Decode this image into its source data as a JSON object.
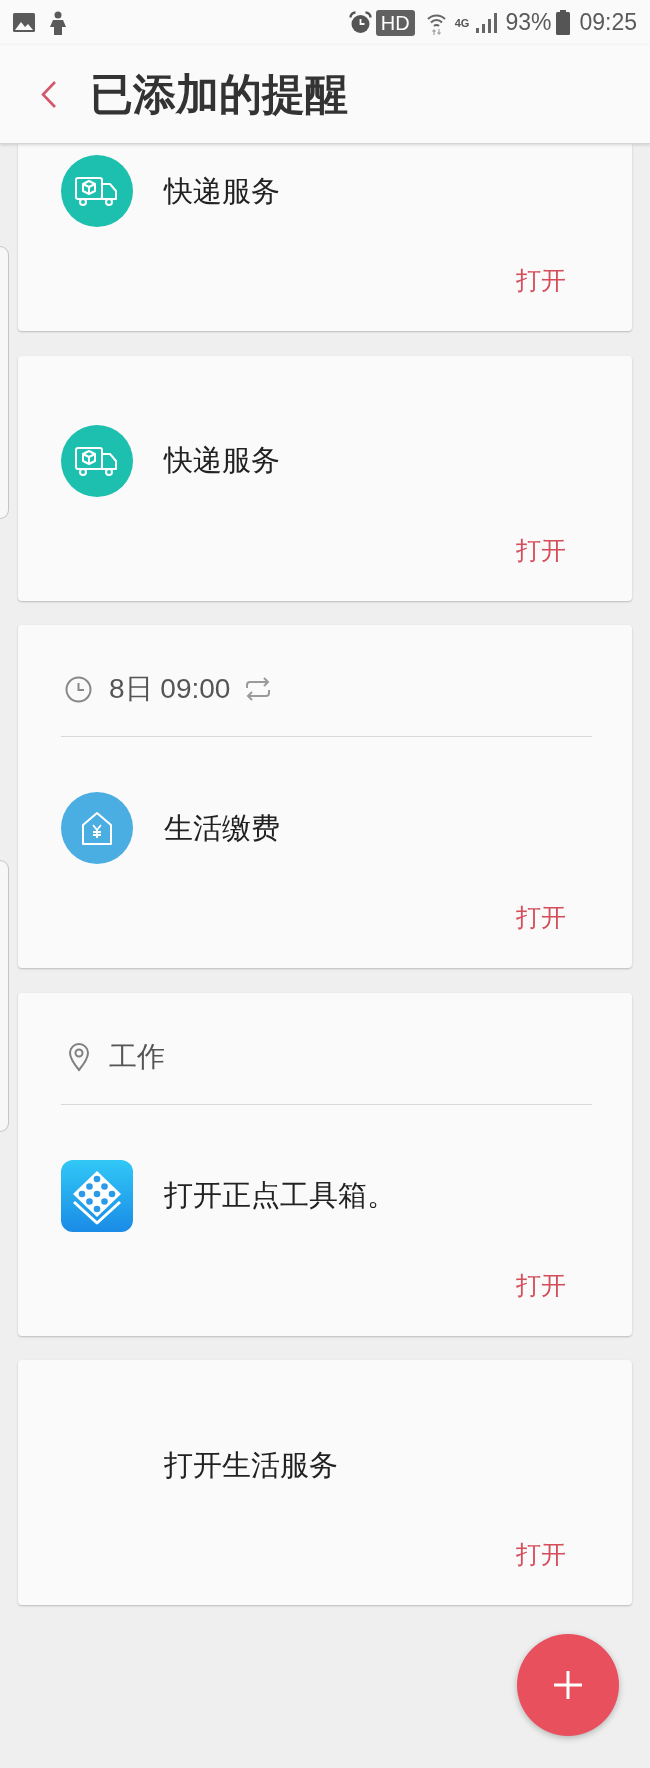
{
  "status_bar": {
    "hd_badge": "HD",
    "network_type": "4G",
    "battery_percent": "93%",
    "time": "09:25"
  },
  "header": {
    "title": "已添加的提醒"
  },
  "reminders": [
    {
      "kind": "delivery",
      "text": "快递服务",
      "action": "打开"
    },
    {
      "kind": "delivery",
      "text": "快递服务",
      "action": "打开"
    },
    {
      "trigger": {
        "kind": "time",
        "text": "8日 09:00",
        "repeat": true
      },
      "kind": "payment",
      "text": "生活缴费",
      "action": "打开"
    },
    {
      "trigger": {
        "kind": "place",
        "text": "工作"
      },
      "kind": "app",
      "text": "打开正点工具箱。",
      "action": "打开"
    },
    {
      "kind": "plain",
      "text": "打开生活服务",
      "action": "打开"
    }
  ]
}
